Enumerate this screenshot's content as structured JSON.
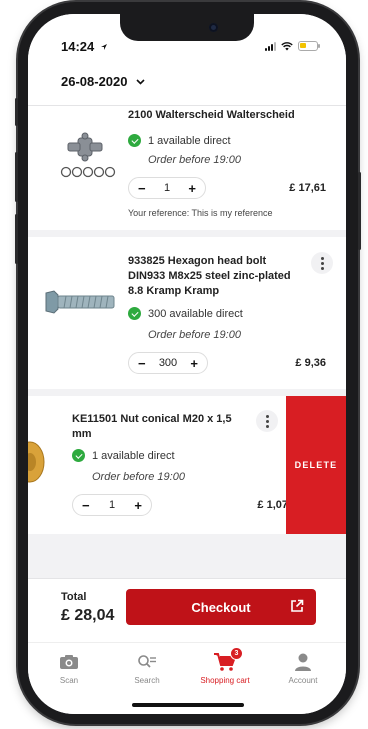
{
  "status": {
    "time": "14:24"
  },
  "header": {
    "date": "26-08-2020"
  },
  "cart": {
    "items": [
      {
        "name": "2100 Walterscheid Walterscheid",
        "availability": "1 available direct",
        "order_note": "Order before 19:00",
        "quantity": "1",
        "price": "£ 17,61",
        "reference": "Your reference: This is my reference"
      },
      {
        "name": "933825 Hexagon head bolt DIN933 M8x25 steel zinc-plated 8.8 Kramp Kramp",
        "availability": "300 available direct",
        "order_note": "Order before 19:00",
        "quantity": "300",
        "price": "£ 9,36"
      },
      {
        "name": "KE11501 Nut conical M20 x 1,5 mm",
        "availability": "1 available direct",
        "order_note": "Order before 19:00",
        "quantity": "1",
        "price": "£ 1,07",
        "delete_label": "DELETE"
      }
    ],
    "stepper": {
      "minus": "−",
      "plus": "+"
    }
  },
  "footer": {
    "total_label": "Total",
    "total_value": "£ 28,04",
    "checkout_label": "Checkout"
  },
  "tabbar": {
    "tabs": [
      {
        "label": "Scan",
        "icon": "camera-icon"
      },
      {
        "label": "Search",
        "icon": "search-icon"
      },
      {
        "label": "Shopping cart",
        "icon": "cart-icon",
        "badge": "3"
      },
      {
        "label": "Account",
        "icon": "account-icon"
      }
    ]
  },
  "colors": {
    "accent": "#d81e23",
    "checkout": "#bf1218",
    "available": "#2eaa3f"
  }
}
